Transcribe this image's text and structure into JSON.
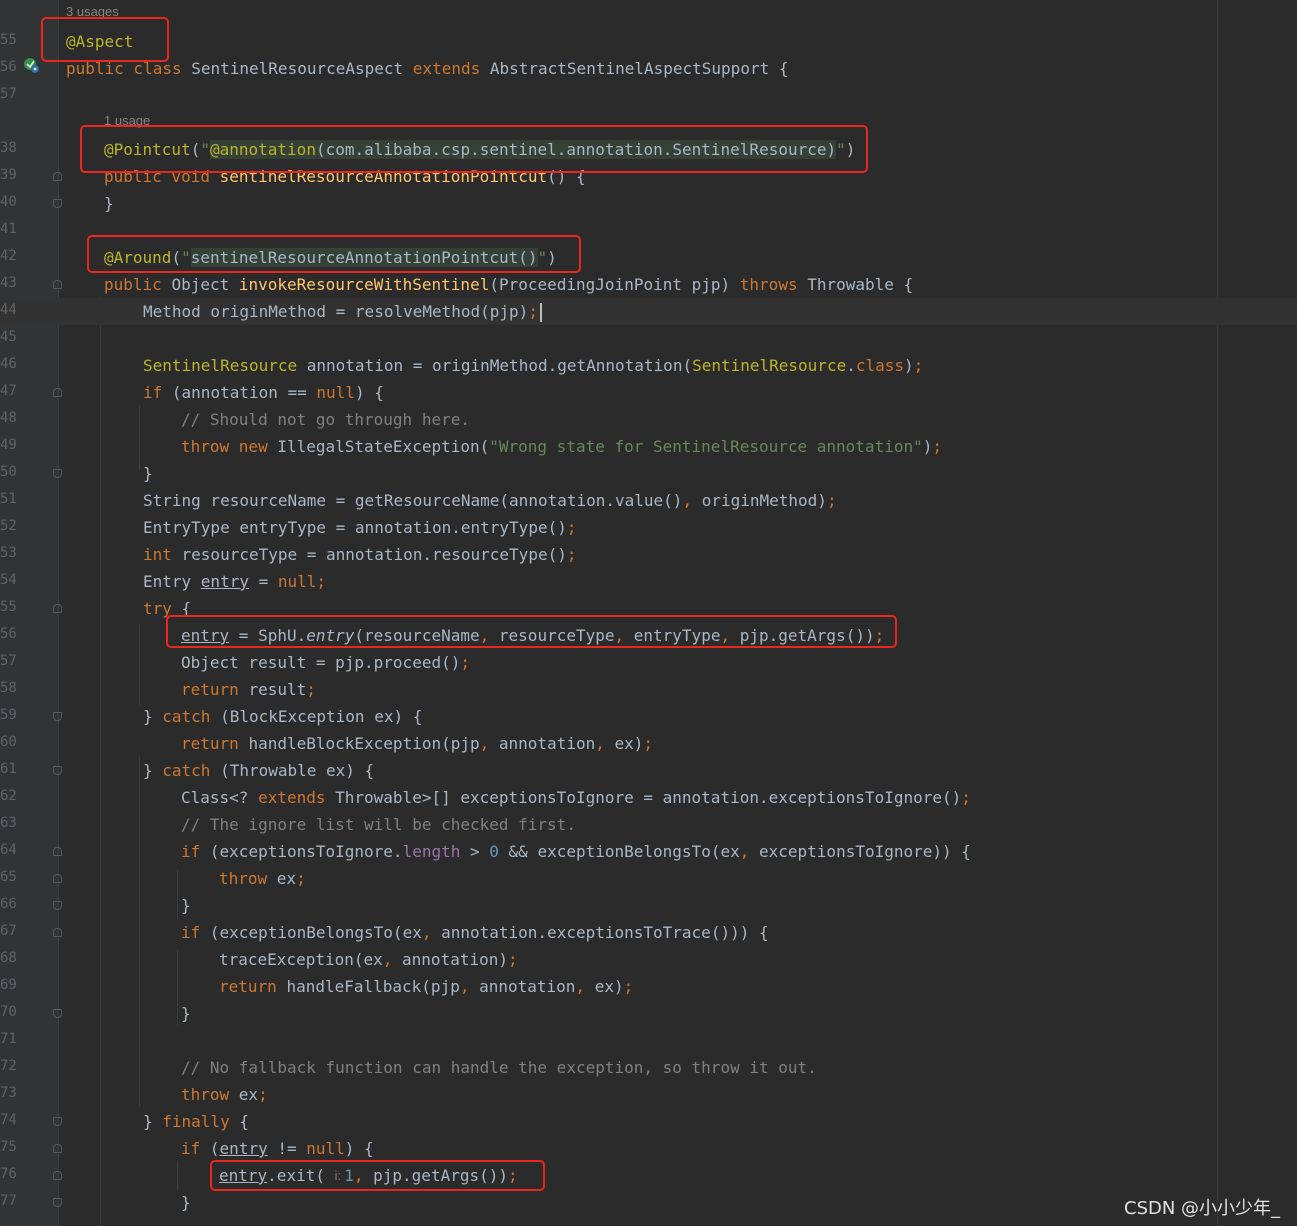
{
  "editor": {
    "gutter_icon": "override-run-icon",
    "hints": {
      "usages_class": "3 usages",
      "usages_pointcut": "1 usage",
      "param_hint": "i:"
    },
    "lines": [
      {
        "num": "55",
        "tokens": [
          [
            "an",
            "@Aspect"
          ]
        ]
      },
      {
        "num": "56",
        "tokens": [
          [
            "kw",
            "public class "
          ],
          [
            "tk",
            "SentinelResourceAspect "
          ],
          [
            "kw",
            "extends "
          ],
          [
            "tk",
            "AbstractSentinelAspectSupport {"
          ]
        ]
      },
      {
        "num": "57",
        "tokens": []
      },
      {
        "num": "38",
        "tokens": [
          [
            "an",
            "@Pointcut"
          ],
          [
            "tk",
            "("
          ],
          [
            "st",
            "\""
          ],
          [
            "an inj",
            "@annotation"
          ],
          [
            "tk inj",
            "(com.alibaba.csp.sentinel.annotation.SentinelResource)"
          ],
          [
            "st",
            "\""
          ],
          [
            "tk",
            ")"
          ]
        ]
      },
      {
        "num": "39",
        "tokens": [
          [
            "kw",
            "public void "
          ],
          [
            "fn",
            "sentinelResourceAnnotationPointcut"
          ],
          [
            "tk",
            "() {"
          ]
        ]
      },
      {
        "num": "40",
        "tokens": [
          [
            "tk",
            "}"
          ]
        ]
      },
      {
        "num": "41",
        "tokens": []
      },
      {
        "num": "42",
        "tokens": [
          [
            "an",
            "@Around"
          ],
          [
            "tk",
            "("
          ],
          [
            "st",
            "\""
          ],
          [
            "tk inj",
            "sentinelResourceAnnotationPointcut()"
          ],
          [
            "st",
            "\""
          ],
          [
            "tk",
            ")"
          ]
        ]
      },
      {
        "num": "43",
        "tokens": [
          [
            "kw",
            "public "
          ],
          [
            "tk",
            "Object "
          ],
          [
            "fn",
            "invokeResourceWithSentinel"
          ],
          [
            "tk",
            "(ProceedingJoinPoint pjp) "
          ],
          [
            "kw",
            "throws "
          ],
          [
            "tk",
            "Throwable {"
          ]
        ]
      },
      {
        "num": "44",
        "tokens": [
          [
            "tk",
            "Method originMethod = resolveMethod(pjp)"
          ],
          [
            "kw",
            ";"
          ]
        ]
      },
      {
        "num": "45",
        "tokens": []
      },
      {
        "num": "46",
        "tokens": [
          [
            "an",
            "SentinelResource "
          ],
          [
            "tk",
            "annotation = originMethod.getAnnotation("
          ],
          [
            "an",
            "SentinelResource"
          ],
          [
            "tk",
            "."
          ],
          [
            "kw",
            "class"
          ],
          [
            "tk",
            ")"
          ],
          [
            "kw",
            ";"
          ]
        ]
      },
      {
        "num": "47",
        "tokens": [
          [
            "kw",
            "if "
          ],
          [
            "tk",
            "(annotation == "
          ],
          [
            "kw",
            "null"
          ],
          [
            "tk",
            ") {"
          ]
        ]
      },
      {
        "num": "48",
        "tokens": [
          [
            "cm",
            "// Should not go through here."
          ]
        ]
      },
      {
        "num": "49",
        "tokens": [
          [
            "kw",
            "throw new "
          ],
          [
            "tk",
            "IllegalStateException("
          ],
          [
            "st",
            "\"Wrong state for SentinelResource annotation\""
          ],
          [
            "tk",
            ")"
          ],
          [
            "kw",
            ";"
          ]
        ]
      },
      {
        "num": "50",
        "tokens": [
          [
            "tk",
            "}"
          ]
        ]
      },
      {
        "num": "51",
        "tokens": [
          [
            "tk",
            "String resourceName = getResourceName(annotation.value()"
          ],
          [
            "kw",
            ", "
          ],
          [
            "tk",
            "originMethod)"
          ],
          [
            "kw",
            ";"
          ]
        ]
      },
      {
        "num": "52",
        "tokens": [
          [
            "tk",
            "EntryType entryType = annotation.entryType()"
          ],
          [
            "kw",
            ";"
          ]
        ]
      },
      {
        "num": "53",
        "tokens": [
          [
            "kw",
            "int "
          ],
          [
            "tk",
            "resourceType = annotation.resourceType()"
          ],
          [
            "kw",
            ";"
          ]
        ]
      },
      {
        "num": "54",
        "tokens": [
          [
            "tk",
            "Entry "
          ],
          [
            "tk ul",
            "entry"
          ],
          [
            "tk",
            " = "
          ],
          [
            "kw",
            "null"
          ],
          [
            "kw",
            ";"
          ]
        ]
      },
      {
        "num": "55",
        "tokens": [
          [
            "kw",
            "try "
          ],
          [
            "tk",
            "{"
          ]
        ]
      },
      {
        "num": "56",
        "tokens": [
          [
            "tk ul",
            "entry"
          ],
          [
            "tk",
            " = SphU."
          ],
          [
            "tk it",
            "entry"
          ],
          [
            "tk",
            "(resourceName"
          ],
          [
            "kw",
            ", "
          ],
          [
            "tk",
            "resourceType"
          ],
          [
            "kw",
            ", "
          ],
          [
            "tk",
            "entryType"
          ],
          [
            "kw",
            ", "
          ],
          [
            "tk",
            "pjp.getArgs())"
          ],
          [
            "kw",
            ";"
          ]
        ]
      },
      {
        "num": "57",
        "tokens": [
          [
            "tk",
            "Object result = pjp.proceed()"
          ],
          [
            "kw",
            ";"
          ]
        ]
      },
      {
        "num": "58",
        "tokens": [
          [
            "kw",
            "return "
          ],
          [
            "tk",
            "result"
          ],
          [
            "kw",
            ";"
          ]
        ]
      },
      {
        "num": "59",
        "tokens": [
          [
            "tk",
            "} "
          ],
          [
            "kw",
            "catch "
          ],
          [
            "tk",
            "(BlockException ex) {"
          ]
        ]
      },
      {
        "num": "60",
        "tokens": [
          [
            "kw",
            "return "
          ],
          [
            "tk",
            "handleBlockException(pjp"
          ],
          [
            "kw",
            ", "
          ],
          [
            "tk",
            "annotation"
          ],
          [
            "kw",
            ", "
          ],
          [
            "tk",
            "ex)"
          ],
          [
            "kw",
            ";"
          ]
        ]
      },
      {
        "num": "61",
        "tokens": [
          [
            "tk",
            "} "
          ],
          [
            "kw",
            "catch "
          ],
          [
            "tk",
            "(Throwable ex) {"
          ]
        ]
      },
      {
        "num": "62",
        "tokens": [
          [
            "tk",
            "Class<? "
          ],
          [
            "kw",
            "extends "
          ],
          [
            "tk",
            "Throwable>[] exceptionsToIgnore = annotation.exceptionsToIgnore()"
          ],
          [
            "kw",
            ";"
          ]
        ]
      },
      {
        "num": "63",
        "tokens": [
          [
            "cm",
            "// The ignore list will be checked first."
          ]
        ]
      },
      {
        "num": "64",
        "tokens": [
          [
            "kw",
            "if "
          ],
          [
            "tk",
            "(exceptionsToIgnore."
          ],
          [
            "fd",
            "length"
          ],
          [
            "tk",
            " > "
          ],
          [
            "nm",
            "0"
          ],
          [
            "tk",
            " && exceptionBelongsTo(ex"
          ],
          [
            "kw",
            ", "
          ],
          [
            "tk",
            "exceptionsToIgnore)) {"
          ]
        ]
      },
      {
        "num": "65",
        "tokens": [
          [
            "kw",
            "throw "
          ],
          [
            "tk",
            "ex"
          ],
          [
            "kw",
            ";"
          ]
        ]
      },
      {
        "num": "66",
        "tokens": [
          [
            "tk",
            "}"
          ]
        ]
      },
      {
        "num": "67",
        "tokens": [
          [
            "kw",
            "if "
          ],
          [
            "tk",
            "(exceptionBelongsTo(ex"
          ],
          [
            "kw",
            ", "
          ],
          [
            "tk",
            "annotation.exceptionsToTrace())) {"
          ]
        ]
      },
      {
        "num": "68",
        "tokens": [
          [
            "tk",
            "traceException(ex"
          ],
          [
            "kw",
            ", "
          ],
          [
            "tk",
            "annotation)"
          ],
          [
            "kw",
            ";"
          ]
        ]
      },
      {
        "num": "69",
        "tokens": [
          [
            "kw",
            "return "
          ],
          [
            "tk",
            "handleFallback(pjp"
          ],
          [
            "kw",
            ", "
          ],
          [
            "tk",
            "annotation"
          ],
          [
            "kw",
            ", "
          ],
          [
            "tk",
            "ex)"
          ],
          [
            "kw",
            ";"
          ]
        ]
      },
      {
        "num": "70",
        "tokens": [
          [
            "tk",
            "}"
          ]
        ]
      },
      {
        "num": "71",
        "tokens": []
      },
      {
        "num": "72",
        "tokens": [
          [
            "cm",
            "// No fallback function can handle the exception, so throw it out."
          ]
        ]
      },
      {
        "num": "73",
        "tokens": [
          [
            "kw",
            "throw "
          ],
          [
            "tk",
            "ex"
          ],
          [
            "kw",
            ";"
          ]
        ]
      },
      {
        "num": "74",
        "tokens": [
          [
            "tk",
            "} "
          ],
          [
            "kw",
            "finally "
          ],
          [
            "tk",
            "{"
          ]
        ]
      },
      {
        "num": "75",
        "tokens": [
          [
            "kw",
            "if "
          ],
          [
            "tk",
            "("
          ],
          [
            "tk ul",
            "entry"
          ],
          [
            "tk",
            " != "
          ],
          [
            "kw",
            "null"
          ],
          [
            "tk",
            ") {"
          ]
        ]
      },
      {
        "num": "76",
        "tokens": [
          [
            "tk ul",
            "entry"
          ],
          [
            "tk",
            ".exit( "
          ],
          [
            "hint",
            "i:"
          ],
          [
            "nm",
            " 1"
          ],
          [
            "kw",
            ", "
          ],
          [
            "tk",
            "pjp.getArgs())"
          ],
          [
            "kw",
            ";"
          ]
        ]
      },
      {
        "num": "77",
        "tokens": [
          [
            "tk",
            "}"
          ]
        ]
      }
    ]
  },
  "watermark": "CSDN @小小少年_"
}
